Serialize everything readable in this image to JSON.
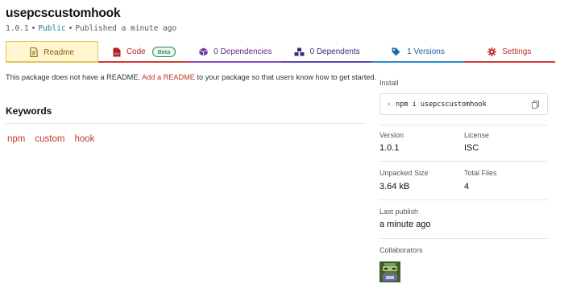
{
  "package": {
    "name": "usepcscustomhook",
    "version": "1.0.1",
    "visibility": "Public",
    "published": "Published a minute ago"
  },
  "tabs": [
    {
      "label": "Readme",
      "icon": "readme-icon",
      "color": "#8a6200",
      "active": true
    },
    {
      "label": "Code",
      "icon": "code-icon",
      "badge": "Beta",
      "color": "#b02020"
    },
    {
      "label": "0 Dependencies",
      "icon": "dependencies-box-icon",
      "color": "#5a2c8a"
    },
    {
      "label": "0 Dependents",
      "icon": "dependents-cubes-icon",
      "color": "#3a2a80"
    },
    {
      "label": "1 Versions",
      "icon": "versions-tag-icon",
      "color": "#1d5fa0"
    },
    {
      "label": "Settings",
      "icon": "settings-gear-icon",
      "color": "#c02828"
    }
  ],
  "readme": {
    "before": "This package does not have a README. ",
    "link": "Add a README",
    "after": " to your package so that users know how to get started."
  },
  "keywords": {
    "heading": "Keywords",
    "items": [
      "npm",
      "custom",
      "hook"
    ]
  },
  "sidebar": {
    "install_label": "Install",
    "install_command": "npm i usepcscustomhook",
    "version_label": "Version",
    "version_value": "1.0.1",
    "license_label": "License",
    "license_value": "ISC",
    "unpacked_label": "Unpacked Size",
    "unpacked_value": "3.64 kB",
    "files_label": "Total Files",
    "files_value": "4",
    "last_publish_label": "Last publish",
    "last_publish_value": "a minute ago",
    "collaborators_label": "Collaborators"
  },
  "colors": {
    "link_red": "#c0392b",
    "public_teal": "#1f7a8c",
    "tab_active_bg": "#fff5d1"
  }
}
